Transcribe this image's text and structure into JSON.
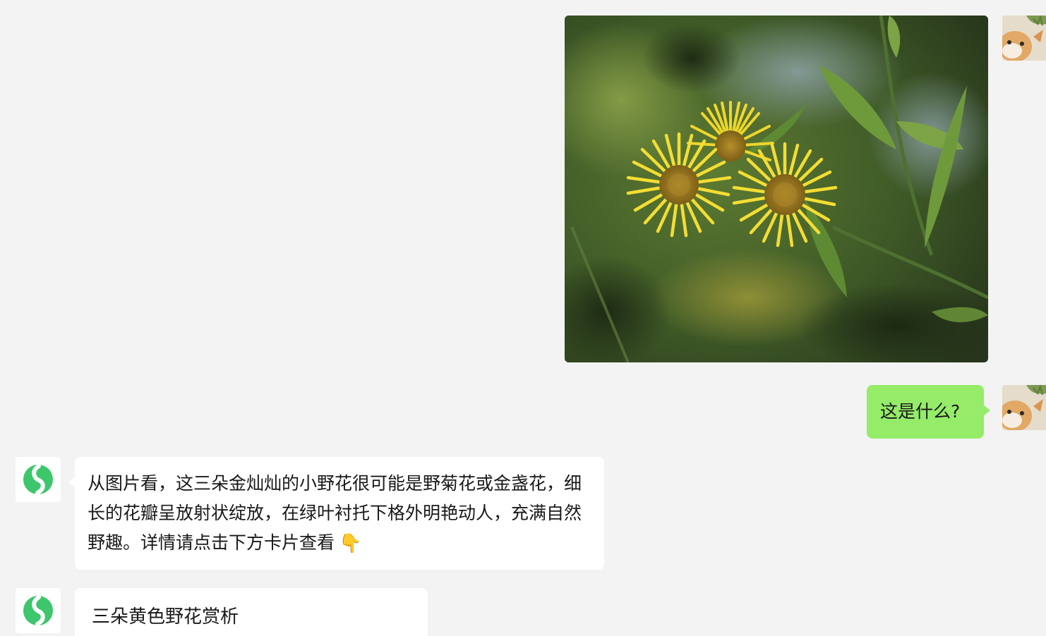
{
  "conversation": {
    "user_question": "这是什么?",
    "bot_reply": "从图片看，这三朵金灿灿的小野花很可能是野菊花或金盏花，细长的花瓣呈放射状绽放，在绿叶衬托下格外明艳动人，充满自然野趣。详情请点击下方卡片查看",
    "bot_reply_emoji": "👇",
    "card_title": "三朵黄色野花赏析"
  },
  "icons": {
    "user_avatar": "cat-avatar-icon",
    "bot_avatar": "green-swirl-logo-icon"
  },
  "colors": {
    "background": "#f3f3f3",
    "user_bubble": "#95ec69",
    "bot_bubble": "#ffffff",
    "bot_logo": "#3dc66c",
    "flower_petal": "#f0d62a"
  }
}
